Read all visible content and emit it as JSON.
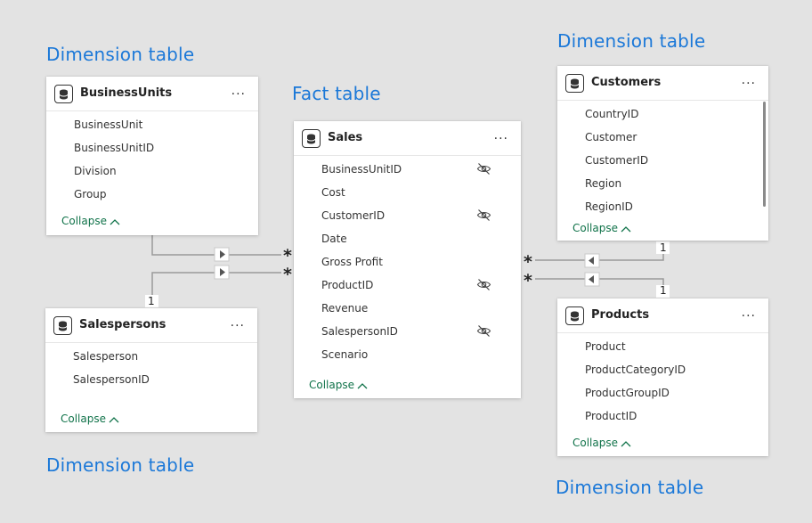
{
  "annotations": {
    "dim_top_left": "Dimension table",
    "fact": "Fact table",
    "dim_top_right": "Dimension table",
    "dim_bottom_left": "Dimension table",
    "dim_bottom_right": "Dimension table"
  },
  "tables": {
    "businessunits": {
      "title": "BusinessUnits",
      "more": "...",
      "fields": [
        "BusinessUnit",
        "BusinessUnitID",
        "Division",
        "Group"
      ],
      "collapse": "Collapse"
    },
    "sales": {
      "title": "Sales",
      "more": "...",
      "fields": [
        "BusinessUnitID",
        "Cost",
        "CustomerID",
        "Date",
        "Gross Profit",
        "ProductID",
        "Revenue",
        "SalespersonID",
        "Scenario"
      ],
      "hidden_fields": [
        "BusinessUnitID",
        "CustomerID",
        "ProductID",
        "SalespersonID"
      ],
      "collapse": "Collapse"
    },
    "customers": {
      "title": "Customers",
      "more": "...",
      "fields": [
        "CountryID",
        "Customer",
        "CustomerID",
        "Region",
        "RegionID"
      ],
      "collapse": "Collapse"
    },
    "salespersons": {
      "title": "Salespersons",
      "more": "...",
      "fields": [
        "Salesperson",
        "SalespersonID"
      ],
      "collapse": "Collapse"
    },
    "products": {
      "title": "Products",
      "more": "...",
      "fields": [
        "Product",
        "ProductCategoryID",
        "ProductGroupID",
        "ProductID"
      ],
      "collapse": "Collapse"
    }
  },
  "relationships": {
    "many": "*",
    "one": "1"
  },
  "colors": {
    "annotation": "#1b78d8",
    "collapse": "#11734a",
    "line": "#9a9a9a"
  }
}
